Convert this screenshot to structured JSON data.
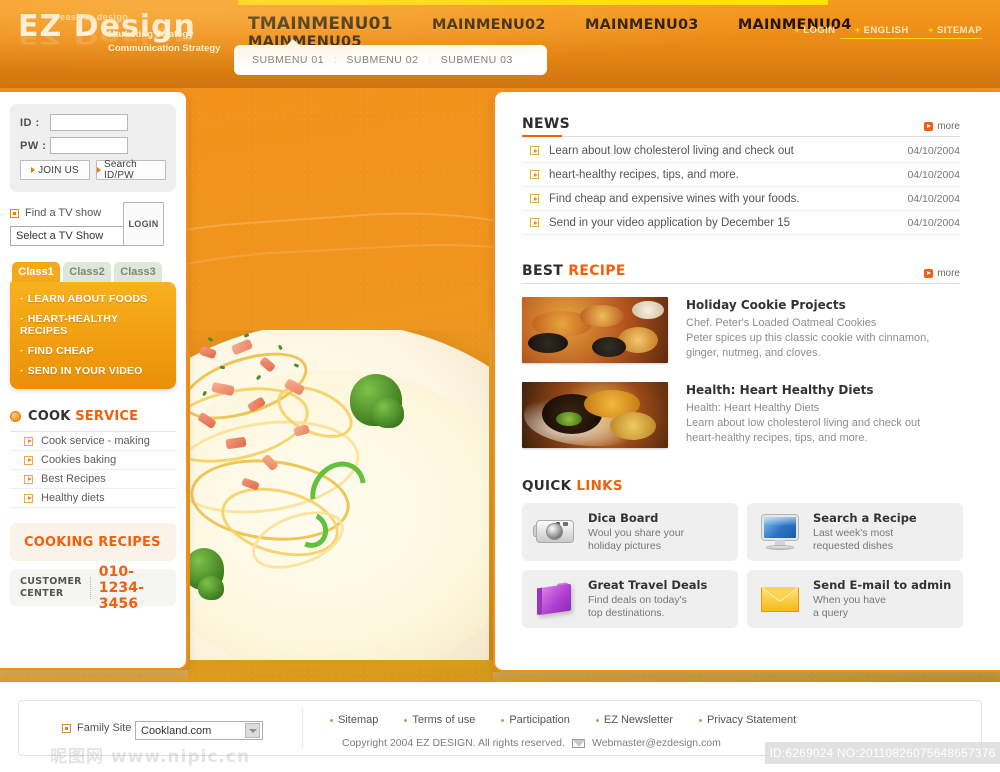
{
  "header": {
    "logo": {
      "main": "EZ Design",
      "tagline": "easy to design"
    },
    "slogan_line1": "Marketing Strategy",
    "slogan_line2": "Communication Strategy",
    "mainmenu": [
      {
        "label": "TMAINMENU01",
        "active": true
      },
      {
        "label": "MAINMENU02",
        "active": false
      },
      {
        "label": "MAINMENU03",
        "active": false
      },
      {
        "label": "MAINMENU04",
        "active": false
      },
      {
        "label": "MAINMENU05",
        "active": false
      }
    ],
    "submenu": [
      "SUBMENU 01",
      "SUBMENU 02",
      "SUBMENU 03"
    ],
    "separator": ":",
    "utils": [
      "LOGIN",
      "ENGLISH",
      "SITEMAP"
    ],
    "util_bullet": "•",
    "accent_yellow": "#ffe400",
    "accent_orange": "#f68b1f"
  },
  "sidebar": {
    "login": {
      "id_label": "ID :",
      "pw_label": "PW :",
      "id_value": "",
      "pw_value": "",
      "id_placeholder": "",
      "pw_placeholder": "",
      "login_button": "LOGIN",
      "join_button": "JOIN US",
      "search_button": "Search ID/PW"
    },
    "tvshow": {
      "label": "Find a TV show",
      "selected": "Select a TV Show"
    },
    "classtabs": [
      {
        "label": "Class1",
        "active": true
      },
      {
        "label": "Class2",
        "active": false
      },
      {
        "label": "Class3",
        "active": false
      }
    ],
    "classitems": [
      "LEARN ABOUT FOODS",
      "HEART-HEALTHY RECIPES",
      "FIND CHEAP",
      "SEND IN YOUR VIDEO"
    ],
    "cook_service": {
      "title_strong": "COOK",
      "title_accent": "SERVICE",
      "items": [
        "Cook service - making",
        "Cookies baking",
        "Best Recipes",
        "Healthy diets"
      ]
    },
    "recipes_banner": "COOKING RECIPES",
    "customer": {
      "label_line1": "CUSTOMER",
      "label_line2": "CENTER",
      "phone": "010-1234-3456"
    }
  },
  "content": {
    "news": {
      "title": "NEWS",
      "more": "more",
      "items": [
        {
          "title": "Learn about low cholesterol living and check out",
          "date": "04/10/2004"
        },
        {
          "title": "heart-healthy recipes, tips, and more.",
          "date": "04/10/2004"
        },
        {
          "title": "Find cheap and expensive wines with your foods.",
          "date": "04/10/2004"
        },
        {
          "title": "Send in your video application by December 15",
          "date": "04/10/2004"
        }
      ]
    },
    "best_recipe": {
      "title_strong": "BEST",
      "title_accent": "RECIPE",
      "more": "more",
      "items": [
        {
          "title": "Holiday Cookie Projects",
          "desc_line1": "Chef. Peter's Loaded Oatmeal Cookies",
          "desc_line2": "Peter spices up this classic cookie with cinnamon,",
          "desc_line3": "ginger, nutmeg, and cloves."
        },
        {
          "title": "Health: Heart Healthy Diets",
          "desc_line1": "Health: Heart Healthy Diets",
          "desc_line2": "Learn about low cholesterol living and check out",
          "desc_line3": "heart-healthy recipes, tips, and more."
        }
      ]
    },
    "quick_links": {
      "title_strong": "QUICK",
      "title_accent": "LINKS",
      "items": [
        {
          "icon": "camera-icon",
          "title": "Dica Board",
          "desc_line1": "Woul you share your",
          "desc_line2": "holiday pictures"
        },
        {
          "icon": "monitor-icon",
          "title": "Search a Recipe",
          "desc_line1": "Last week's most",
          "desc_line2": "requested dishes"
        },
        {
          "icon": "book-icon",
          "title": "Great Travel Deals",
          "desc_line1": "Find deals on today's",
          "desc_line2": "top destinations."
        },
        {
          "icon": "envelope-icon",
          "title": "Send E-mail to admin",
          "desc_line1": "When you have",
          "desc_line2": "a query"
        }
      ]
    }
  },
  "footer": {
    "family_site_label": "Family Site",
    "family_site_selected": "Cookland.com",
    "links": [
      "Sitemap",
      "Terms of use",
      "Participation",
      "EZ Newsletter",
      "Privacy Statement"
    ],
    "copyright": "Copyright 2004 EZ DESIGN. All rights reserved.",
    "webmaster": "Webmaster@ezdesign.com",
    "watermark": "昵图网 www.nipic.cn",
    "id_stamp": "ID:6269024 NO:20110826075648657376"
  }
}
